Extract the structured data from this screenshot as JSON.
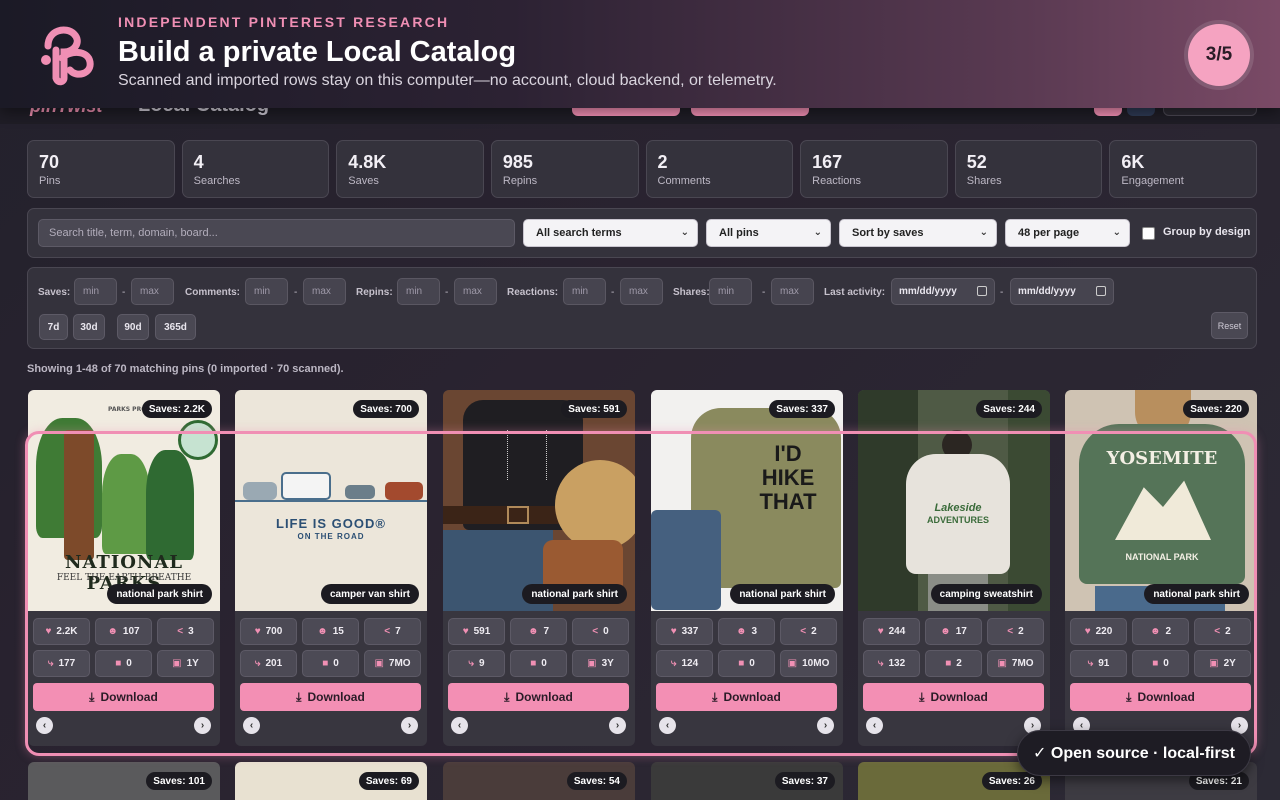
{
  "app": {
    "logo_text": "pinTwist",
    "title": "Local Catalog"
  },
  "banner": {
    "eyebrow": "INDEPENDENT PINTEREST RESEARCH",
    "title": "Build a private Local Catalog",
    "subtitle": "Scanned and imported rows stay on this computer—no account, cloud backend, or telemetry.",
    "step": "3/5"
  },
  "stats": [
    {
      "value": "70",
      "label": "Pins"
    },
    {
      "value": "4",
      "label": "Searches"
    },
    {
      "value": "4.8K",
      "label": "Saves"
    },
    {
      "value": "985",
      "label": "Repins"
    },
    {
      "value": "2",
      "label": "Comments"
    },
    {
      "value": "167",
      "label": "Reactions"
    },
    {
      "value": "52",
      "label": "Shares"
    },
    {
      "value": "6K",
      "label": "Engagement"
    }
  ],
  "filters": {
    "search_placeholder": "Search title, term, domain, board...",
    "term_select": "All search terms",
    "pin_select": "All pins",
    "sort_select": "Sort by saves",
    "page_select": "48 per page",
    "group_label": "Group by design"
  },
  "ranges": {
    "saves": "Saves:",
    "comments": "Comments:",
    "repins": "Repins:",
    "reactions": "Reactions:",
    "shares": "Shares:",
    "last_activity": "Last activity:",
    "min": "min",
    "max": "max",
    "dash": "-",
    "date_placeholder": "mm/dd/yyyy",
    "chips": [
      "7d",
      "30d",
      "90d",
      "365d"
    ],
    "reset": "Reset"
  },
  "showing": "Showing 1-48 of 70 matching pins (0 imported · 70 scanned).",
  "cards": [
    {
      "saves": "Saves: 2.2K",
      "term": "national park shirt",
      "m": [
        "2.2K",
        "107",
        "3",
        "177",
        "0",
        "1Y"
      ]
    },
    {
      "saves": "Saves: 700",
      "term": "camper van shirt",
      "m": [
        "700",
        "15",
        "7",
        "201",
        "0",
        "7MO"
      ]
    },
    {
      "saves": "Saves: 591",
      "term": "national park shirt",
      "m": [
        "591",
        "7",
        "0",
        "9",
        "0",
        "3Y"
      ]
    },
    {
      "saves": "Saves: 337",
      "term": "national park shirt",
      "m": [
        "337",
        "3",
        "2",
        "124",
        "0",
        "10MO"
      ]
    },
    {
      "saves": "Saves: 244",
      "term": "camping sweatshirt",
      "m": [
        "244",
        "17",
        "2",
        "132",
        "2",
        "7MO"
      ]
    },
    {
      "saves": "Saves: 220",
      "term": "national park shirt",
      "m": [
        "220",
        "2",
        "2",
        "91",
        "0",
        "2Y"
      ]
    }
  ],
  "card_text": {
    "1": {
      "top": "PARKS PROJECT",
      "big": "NATIONAL PARKS",
      "small": "FEEL THE EARTH BREATHE"
    },
    "2": {
      "big": "LIFE IS GOOD®",
      "small": "ON THE ROAD"
    },
    "4": {
      "l1": "I'D",
      "l2": "HIKE",
      "l3": "THAT"
    },
    "5": {
      "l1": "Lakeside",
      "l2": "ADVENTURES"
    },
    "6": {
      "big": "YOSEMITE",
      "small": "NATIONAL PARK"
    }
  },
  "download_label": "Download",
  "arrows": {
    "prev": "‹",
    "next": "›"
  },
  "row2_saves": [
    "Saves: 101",
    "Saves: 69",
    "Saves: 54",
    "Saves: 37",
    "Saves: 26",
    "Saves: 21"
  ],
  "toast": "✓ Open source · local-first",
  "icons": {
    "metric_row1": [
      "heart-icon",
      "emoji-icon",
      "share-icon"
    ],
    "metric_row2": [
      "repin-icon",
      "comment-icon",
      "calendar-icon"
    ],
    "download": "download-icon"
  },
  "colors": {
    "accent": "#f38fb4",
    "background": "#2a2830",
    "card": "#38363f"
  }
}
